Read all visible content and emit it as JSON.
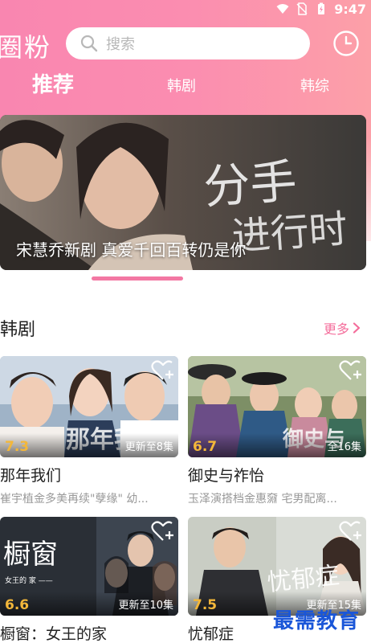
{
  "status_bar": {
    "time": "9:47"
  },
  "app": {
    "logo": "圈粉"
  },
  "search": {
    "placeholder": "搜索"
  },
  "tabs": [
    {
      "label": "推荐",
      "active": true
    },
    {
      "label": "韩剧",
      "active": false
    },
    {
      "label": "韩综",
      "active": false
    }
  ],
  "banner": {
    "caption": "宋慧乔新剧 真爱千回百转仍是你",
    "art_text": "分手进行时"
  },
  "section": {
    "title": "韩剧",
    "more_label": "更多"
  },
  "cards": [
    {
      "rating": "7.3",
      "episode": "更新至8集",
      "title": "那年我们",
      "desc": "崔宇植金多美再续\"孽缘\" 幼...",
      "art_text": "那年我"
    },
    {
      "rating": "6.7",
      "episode": "全16集",
      "title": "御史与祚怡",
      "desc": "玉泽演搭档金惠奫 宅男配离...",
      "art_text": "御史与"
    },
    {
      "rating": "6.6",
      "episode": "更新至10集",
      "title": "橱窗：女王的家",
      "desc": "",
      "art_text": "橱窗",
      "art_sub": "女王的 家"
    },
    {
      "rating": "7.5",
      "episode": "更新至15集",
      "title": "忧郁症",
      "desc": "",
      "art_text": "忧郁症"
    }
  ],
  "watermark": "最需教育",
  "colors": {
    "accent": "#f46d9b",
    "rating": "#f3b73a",
    "header_gradient_start": "#f986b0",
    "header_gradient_end": "#fca0a8"
  }
}
